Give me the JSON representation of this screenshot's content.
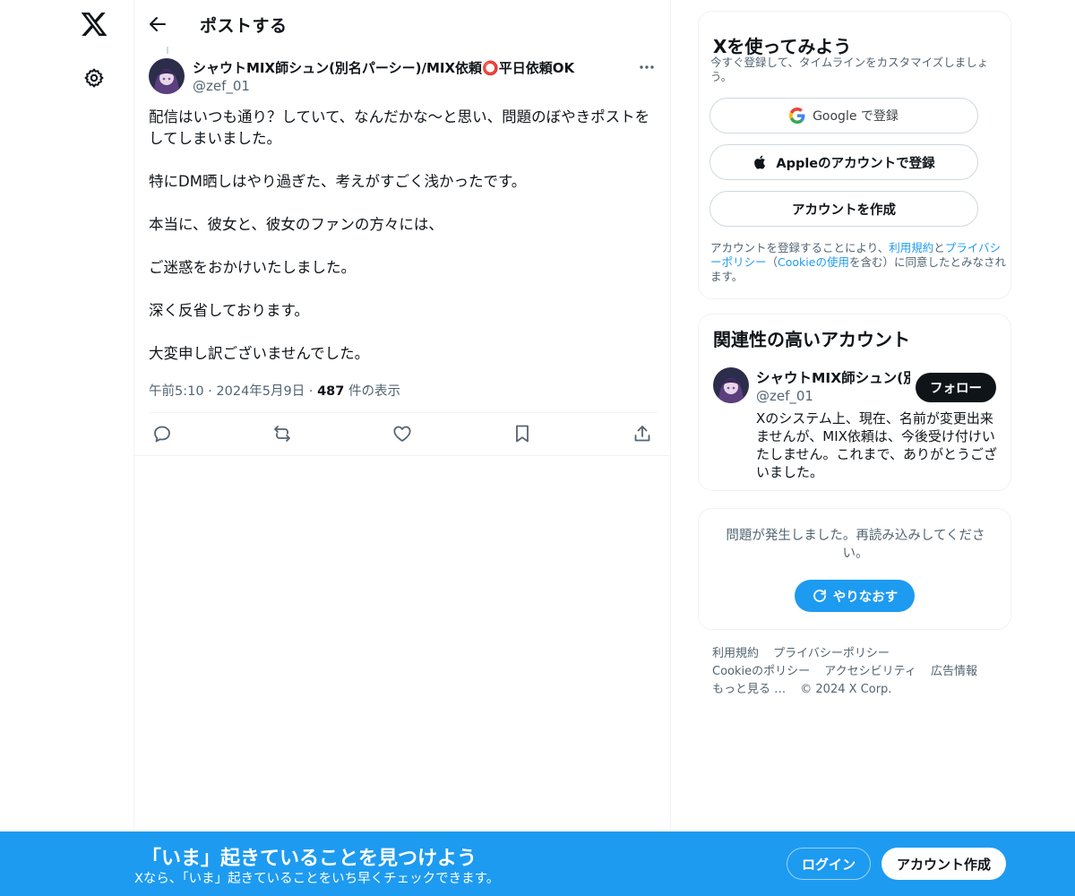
{
  "header": {
    "title": "ポストする"
  },
  "post": {
    "author_name": "シャウトMIX師シュン(別名パーシー)/MIX依頼⭕平日依頼OK",
    "author_handle": "@zef_01",
    "paragraphs": [
      "配信はいつも通り？していて、なんだかな〜と思い、問題のぼやきポストをしてしまいました。",
      "特にDM晒しはやり過ぎた、考えがすごく浅かったです。",
      "本当に、彼女と、彼女のファンの方々には、",
      "ご迷惑をおかけいたしました。",
      "深く反省しております。",
      "大変申し訳ございませんでした。"
    ],
    "time": "午前5:10",
    "date": "2024年5月9日",
    "views_count": "487",
    "views_label": " 件の表示",
    "actions": [
      "reply-icon",
      "repost-icon",
      "like-icon",
      "bookmark-icon",
      "share-icon"
    ]
  },
  "signup": {
    "title": "Xを使ってみよう",
    "subtitle": "今すぐ登録して、タイムラインをカスタマイズしましょう。",
    "google_label": "Google で登録",
    "apple_label": "Appleのアカウントで登録",
    "create_label": "アカウントを作成",
    "legal_prefix": "アカウントを登録することにより、",
    "legal_terms": "利用規約",
    "legal_and": "と",
    "legal_privacy": "プライバシーポリシー",
    "legal_paren_open": "（",
    "legal_cookie": "Cookieの使用",
    "legal_suffix": "を含む）に同意したとみなされます。"
  },
  "related": {
    "title": "関連性の高いアカウント",
    "name": "シャウトMIX師シュン(別",
    "handle": "@zef_01",
    "follow_label": "フォロー",
    "bio": "Xのシステム上、現在、名前が変更出来ませんが、MIX依頼は、今後受け付けいたしません。これまで、ありがとうございました。"
  },
  "error": {
    "message": "問題が発生しました。再読み込みしてください。",
    "retry_label": "やりなおす"
  },
  "footer": {
    "links": [
      "利用規約",
      "プライバシーポリシー",
      "Cookieのポリシー",
      "アクセシビリティ",
      "広告情報",
      "もっと見る …"
    ],
    "copyright": "© 2024 X Corp."
  },
  "bottom_bar": {
    "title": "「いま」起きていることを見つけよう",
    "subtitle": "Xなら、「いま」起きていることをいち早くチェックできます。",
    "login_label": "ログイン",
    "signup_label": "アカウント作成"
  },
  "colors": {
    "accent": "#1d9bf0",
    "text": "#0f1419",
    "secondary_text": "#536471",
    "border": "#eff3f4"
  }
}
